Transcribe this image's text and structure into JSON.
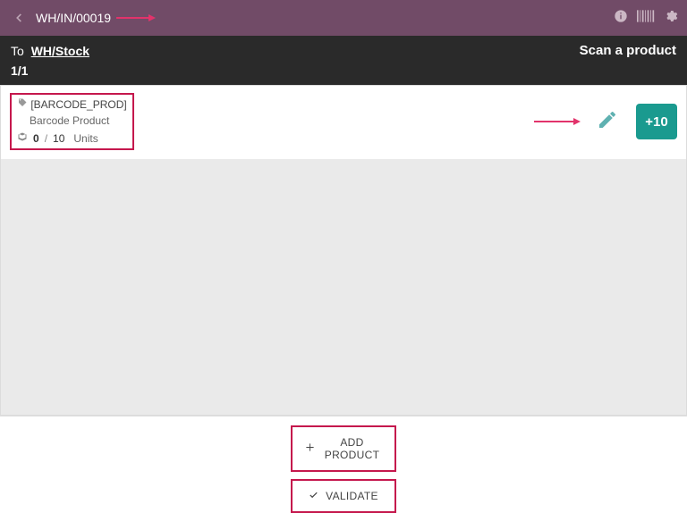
{
  "topbar": {
    "title": "WH/IN/00019"
  },
  "infobar": {
    "to_label": "To",
    "to_value": "WH/Stock",
    "counter": "1/1",
    "scan_prompt": "Scan a product"
  },
  "line": {
    "sku": "[BARCODE_PROD]",
    "name": "Barcode Product",
    "qty_done": "0",
    "qty_sep": "/",
    "qty_total": "10",
    "uom": "Units",
    "increment_label": "+10"
  },
  "footer": {
    "add_product": "ADD PRODUCT",
    "validate": "VALIDATE"
  }
}
